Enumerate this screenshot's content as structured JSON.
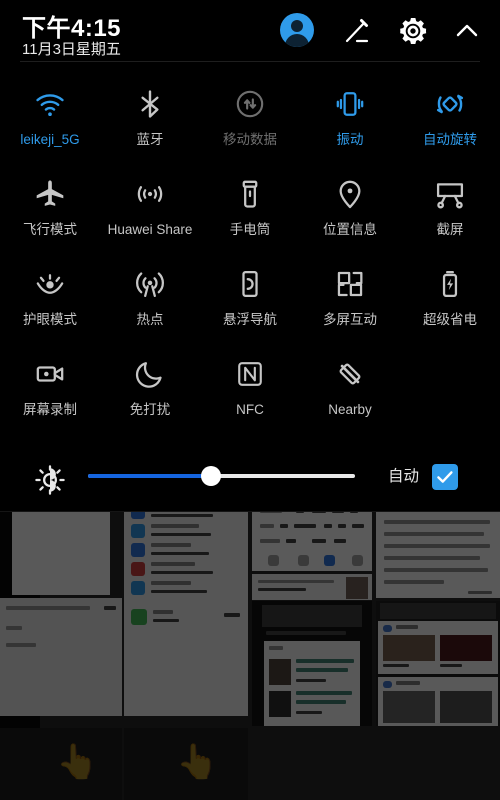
{
  "statusbar": {
    "time": "下午4:15",
    "date": "11月3日星期五"
  },
  "header_icons": [
    {
      "name": "user-avatar",
      "label": "用户"
    },
    {
      "name": "edit-icon",
      "label": "编辑"
    },
    {
      "name": "settings-gear-icon",
      "label": "设置"
    },
    {
      "name": "chevron-up-icon",
      "label": "收起"
    }
  ],
  "quick_settings": {
    "rows": [
      [
        {
          "label": "leikeji_5G",
          "icon": "wifi-icon",
          "state": "on"
        },
        {
          "label": "蓝牙",
          "icon": "bluetooth-icon",
          "state": "off"
        },
        {
          "label": "移动数据",
          "icon": "mobile-data-icon",
          "state": "disabled"
        },
        {
          "label": "振动",
          "icon": "vibrate-icon",
          "state": "on"
        },
        {
          "label": "自动旋转",
          "icon": "auto-rotate-icon",
          "state": "on"
        }
      ],
      [
        {
          "label": "飞行模式",
          "icon": "airplane-icon",
          "state": "off"
        },
        {
          "label": "Huawei Share",
          "icon": "huawei-share-icon",
          "state": "off"
        },
        {
          "label": "手电筒",
          "icon": "flashlight-icon",
          "state": "off"
        },
        {
          "label": "位置信息",
          "icon": "location-pin-icon",
          "state": "off"
        },
        {
          "label": "截屏",
          "icon": "screenshot-icon",
          "state": "off"
        }
      ],
      [
        {
          "label": "护眼模式",
          "icon": "eye-comfort-icon",
          "state": "off"
        },
        {
          "label": "热点",
          "icon": "hotspot-icon",
          "state": "off"
        },
        {
          "label": "悬浮导航",
          "icon": "floating-nav-icon",
          "state": "off"
        },
        {
          "label": "多屏互动",
          "icon": "multi-screen-icon",
          "state": "off"
        },
        {
          "label": "超级省电",
          "icon": "battery-saver-icon",
          "state": "off"
        }
      ],
      [
        {
          "label": "屏幕录制",
          "icon": "screen-record-icon",
          "state": "off"
        },
        {
          "label": "免打扰",
          "icon": "do-not-disturb-icon",
          "state": "off"
        },
        {
          "label": "NFC",
          "icon": "nfc-icon",
          "state": "off"
        },
        {
          "label": "Nearby",
          "icon": "nearby-off-icon",
          "state": "off"
        },
        {
          "label": "",
          "icon": "",
          "state": "empty"
        }
      ]
    ]
  },
  "brightness": {
    "icon": "brightness-icon",
    "value_percent": 46,
    "auto_label": "自动",
    "auto_checked": true
  },
  "colors": {
    "accent_blue": "#2f9bea",
    "slider_fill": "#1565e0",
    "inactive_gray": "#c6c6c6",
    "disabled_gray": "#6f6f6f",
    "panel_background": "#000000"
  }
}
